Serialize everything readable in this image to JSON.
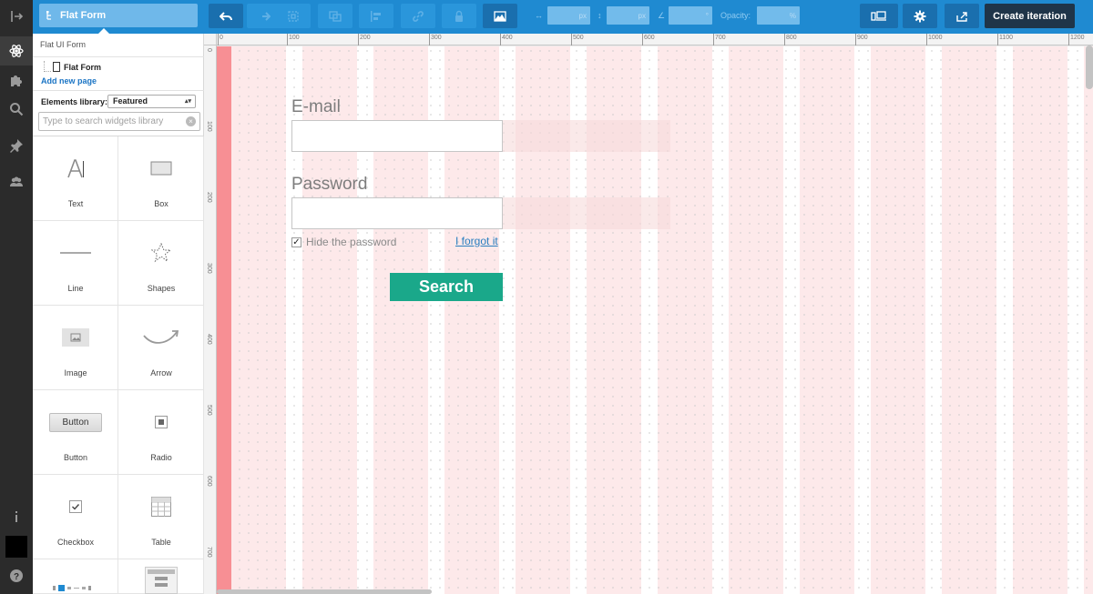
{
  "topbar": {
    "project_name": "Flat Form",
    "width_unit": "px",
    "height_unit": "px",
    "angle_unit": "°",
    "opacity_label": "Opacity:",
    "opacity_unit": "%",
    "create_iteration": "Create iteration"
  },
  "panel": {
    "project_title": "Flat UI Form",
    "page_name": "Flat Form",
    "add_page": "Add new page",
    "library_label": "Elements library:",
    "library_selected": "Featured",
    "search_placeholder": "Type to search widgets library",
    "widgets": [
      {
        "label": "Text",
        "icon": "text-icon"
      },
      {
        "label": "Box",
        "icon": "box-icon"
      },
      {
        "label": "Line",
        "icon": "line-icon"
      },
      {
        "label": "Shapes",
        "icon": "star-icon"
      },
      {
        "label": "Image",
        "icon": "image-icon"
      },
      {
        "label": "Arrow",
        "icon": "arrow-icon"
      },
      {
        "label": "Button",
        "icon": "button-icon",
        "preview": "Button"
      },
      {
        "label": "Radio",
        "icon": "radio-icon"
      },
      {
        "label": "Checkbox",
        "icon": "checkbox-icon"
      },
      {
        "label": "Table",
        "icon": "table-icon"
      }
    ]
  },
  "ruler": {
    "top": [
      "0",
      "100",
      "200",
      "300",
      "400",
      "500",
      "600",
      "700",
      "800",
      "900",
      "1000",
      "1100",
      "1200"
    ],
    "left": [
      "0",
      "100",
      "200",
      "300",
      "400",
      "500",
      "600",
      "700"
    ]
  },
  "form": {
    "email_label": "E-mail",
    "password_label": "Password",
    "hide_password": "Hide the password",
    "forgot_link": "I forgot it",
    "submit": "Search"
  },
  "colors": {
    "accent": "#1f8ad1",
    "submit": "#1aa88a",
    "create_button": "#1f3549",
    "margin": "#f78f94"
  }
}
